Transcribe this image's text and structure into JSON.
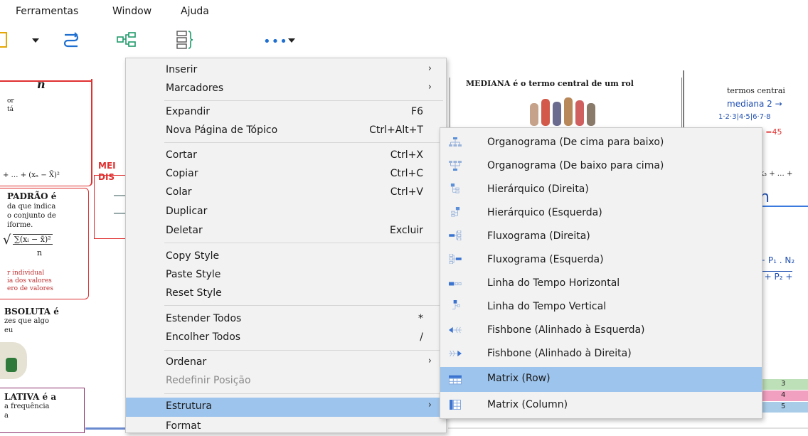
{
  "menubar": {
    "items": [
      "Ferramentas",
      "Window",
      "Ajuda"
    ]
  },
  "canvas": {
    "heading_n": "n",
    "left_frag1": [
      "or",
      "tá"
    ],
    "formula_top": "+ … + (xₙ − X̄)²",
    "padrao_title": "PADRÃO é",
    "padrao_lines": [
      "da que indica",
      "o conjunto de",
      "iforme."
    ],
    "sqrt_formula": "∑(xᵢ − x̄)²",
    "sqrt_den": "n",
    "red_lines": [
      "r individual",
      "ia dos valores",
      "ero de valores"
    ],
    "absoluta_title": "BSOLUTA é",
    "absoluta_lines": [
      "zes que algo",
      "eu"
    ],
    "relativa_title": "LATIVA é a",
    "relativa_lines": [
      "a frequência",
      "a"
    ],
    "med_frag": [
      "MEI",
      "DIS"
    ],
    "mediana_text": "MEDIANA é o termo central de um rol",
    "right_lines": [
      "termos centrai",
      "mediana 2 →",
      "1·2·3|4·5|6·7·8",
      "à =45"
    ],
    "right_formula": "k₃ + … +",
    "right_n": "n",
    "right_p": [
      "+ P₁ . N₂",
      "₂ + P₂ +"
    ],
    "table_nums": [
      "3",
      "4",
      "5"
    ]
  },
  "context_menu": {
    "items": [
      {
        "label": "Inserir",
        "submenu": true
      },
      {
        "label": "Marcadores",
        "submenu": true
      },
      {
        "label": "Expandir",
        "shortcut": "F6"
      },
      {
        "label": "Nova Página de Tópico",
        "shortcut": "Ctrl+Alt+T"
      },
      {
        "label": "Cortar",
        "shortcut": "Ctrl+X"
      },
      {
        "label": "Copiar",
        "shortcut": "Ctrl+C"
      },
      {
        "label": "Colar",
        "shortcut": "Ctrl+V"
      },
      {
        "label": "Duplicar"
      },
      {
        "label": "Deletar",
        "shortcut": "Excluir"
      },
      {
        "label": "Copy Style"
      },
      {
        "label": "Paste Style"
      },
      {
        "label": "Reset Style"
      },
      {
        "label": "Estender Todos",
        "shortcut": "*"
      },
      {
        "label": "Encolher Todos",
        "shortcut": "/"
      },
      {
        "label": "Ordenar",
        "submenu": true
      },
      {
        "label": "Redefinir Posição",
        "disabled": true
      },
      {
        "label": "Estrutura",
        "submenu": true,
        "highlighted": true
      },
      {
        "label": "Format"
      }
    ]
  },
  "submenu": {
    "items": [
      {
        "label": "Organograma (De cima para baixo)",
        "icon": "org-chart-down-icon"
      },
      {
        "label": "Organograma (De baixo para cima)",
        "icon": "org-chart-up-icon"
      },
      {
        "label": "Hierárquico (Direita)",
        "icon": "tree-right-icon"
      },
      {
        "label": "Hierárquico (Esquerda)",
        "icon": "tree-left-icon"
      },
      {
        "label": "Fluxograma (Direita)",
        "icon": "flow-right-icon"
      },
      {
        "label": "Fluxograma (Esquerda)",
        "icon": "flow-left-icon"
      },
      {
        "label": "Linha do Tempo Horizontal",
        "icon": "timeline-horizontal-icon"
      },
      {
        "label": "Linha do Tempo Vertical",
        "icon": "timeline-vertical-icon"
      },
      {
        "label": "Fishbone (Alinhado à Esquerda)",
        "icon": "fishbone-left-icon"
      },
      {
        "label": "Fishbone (Alinhado à Direita)",
        "icon": "fishbone-right-icon"
      },
      {
        "label": "Matrix (Row)",
        "icon": "matrix-row-icon",
        "highlighted": true
      },
      {
        "label": "Matrix (Column)",
        "icon": "matrix-column-icon"
      }
    ]
  },
  "colors": {
    "accent_blue": "#1f6fd1",
    "highlight": "#9dc4ec",
    "topic_red": "#e03030"
  }
}
